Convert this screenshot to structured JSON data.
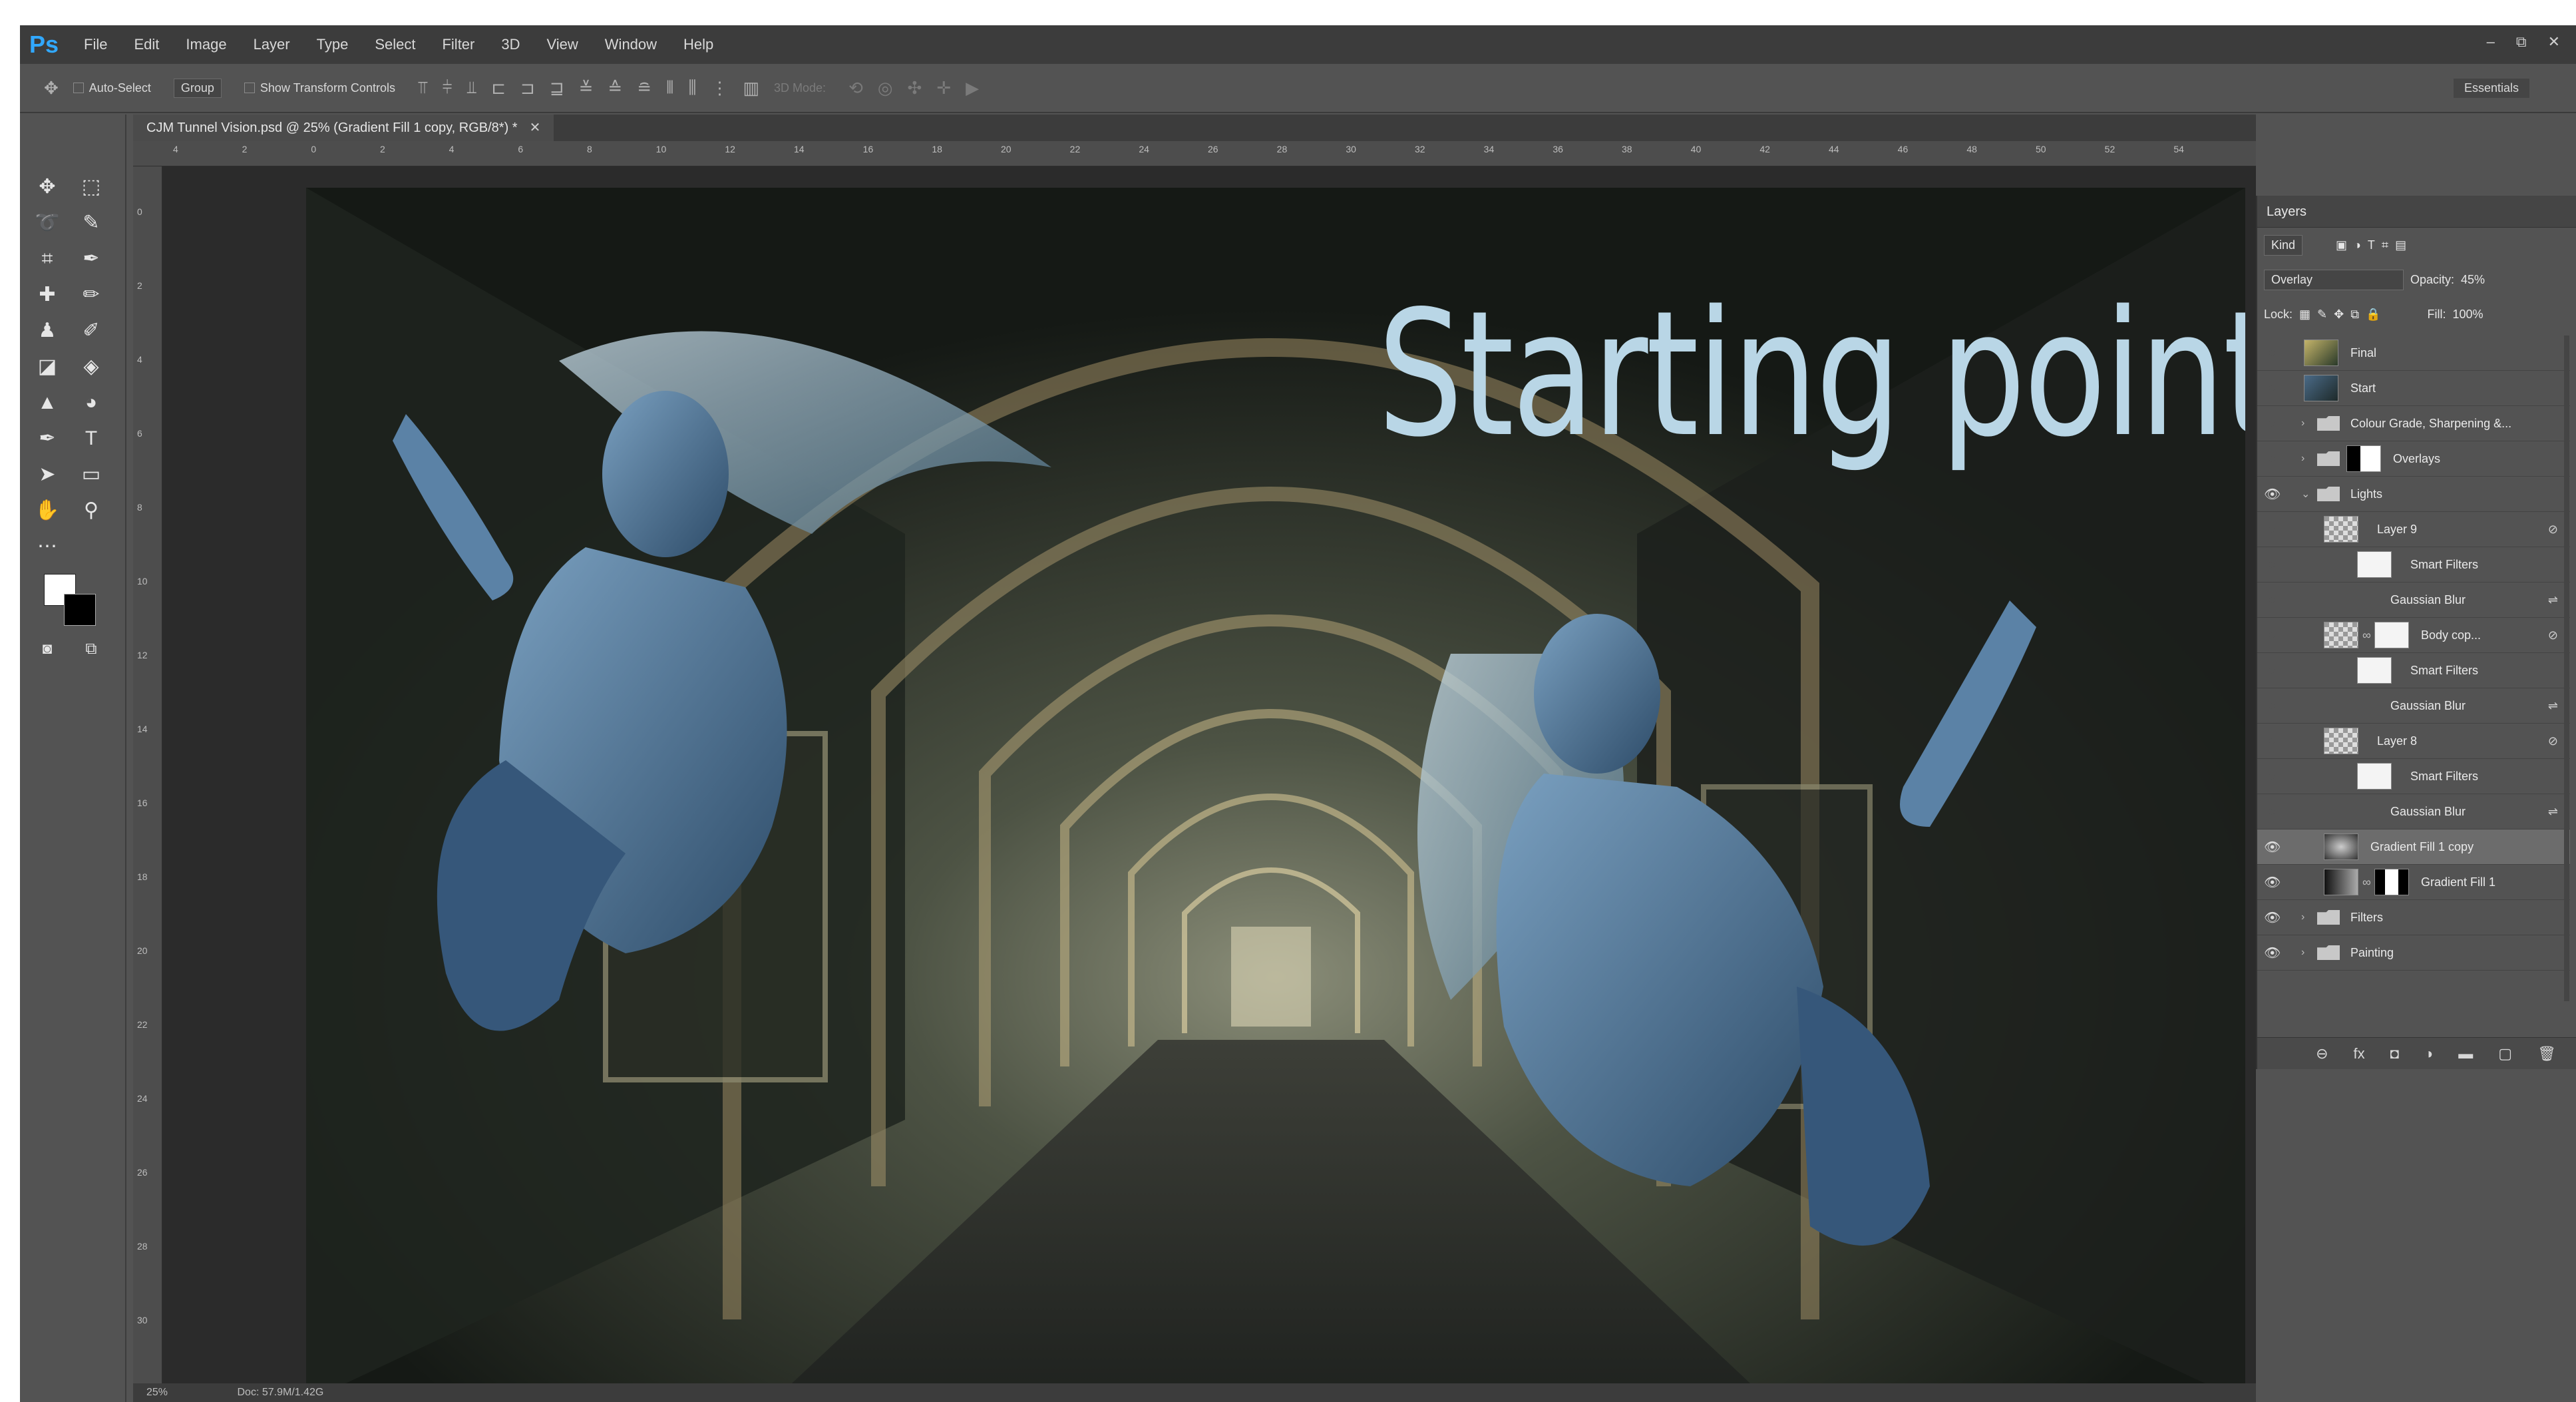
{
  "app": {
    "logo": "Ps"
  },
  "menu": [
    "File",
    "Edit",
    "Image",
    "Layer",
    "Type",
    "Select",
    "Filter",
    "3D",
    "View",
    "Window",
    "Help"
  ],
  "window_controls": {
    "minimize": "–",
    "restore": "⧉",
    "close": "✕"
  },
  "options_bar": {
    "auto_select_label": "Auto-Select",
    "group_value": "Group",
    "show_transform_label": "Show Transform Controls",
    "mode_3d_label": "3D Mode:",
    "workspace": "Essentials"
  },
  "document_tab": {
    "title": "CJM Tunnel Vision.psd @ 25% (Gradient Fill 1 copy, RGB/8*) *",
    "close": "✕"
  },
  "ruler": {
    "top_ticks": [
      "4",
      "2",
      "0",
      "2",
      "4",
      "6",
      "8",
      "10",
      "12",
      "14",
      "16",
      "18",
      "20",
      "22",
      "24",
      "26",
      "28",
      "30",
      "32",
      "34",
      "36",
      "38",
      "40",
      "42",
      "44",
      "46",
      "48",
      "50",
      "52",
      "54"
    ],
    "left_ticks": [
      "0",
      "2",
      "4",
      "6",
      "8",
      "10",
      "12",
      "14",
      "16",
      "18",
      "20",
      "22",
      "24",
      "26",
      "28",
      "30"
    ]
  },
  "canvas": {
    "headline": "Starting point."
  },
  "status_bar": {
    "zoom": "25%",
    "doc": "Doc: 57.9M/1.42G"
  },
  "layers_panel": {
    "tab": "Layers",
    "filter_kind": "Kind",
    "blend_mode": "Overlay",
    "opacity_label": "Opacity:",
    "opacity_value": "45%",
    "lock_label": "Lock:",
    "fill_label": "Fill:",
    "fill_value": "100%",
    "layers": [
      {
        "name": "Final",
        "type": "image",
        "visible": false
      },
      {
        "name": "Start",
        "type": "image",
        "visible": false
      },
      {
        "name": "Colour Grade, Sharpening &...",
        "type": "group",
        "visible": false
      },
      {
        "name": "Overlays",
        "type": "group-mask",
        "visible": false
      },
      {
        "name": "Lights",
        "type": "group-open",
        "visible": true
      },
      {
        "name": "Layer 9",
        "type": "smart",
        "visible": false
      },
      {
        "name": "Smart Filters",
        "type": "filter-mask",
        "visible": false
      },
      {
        "name": "Gaussian Blur",
        "type": "filter",
        "visible": false
      },
      {
        "name": "Body cop...",
        "type": "smart-mask",
        "visible": false
      },
      {
        "name": "Smart Filters",
        "type": "filter-mask",
        "visible": false
      },
      {
        "name": "Gaussian Blur",
        "type": "filter",
        "visible": false
      },
      {
        "name": "Layer 8",
        "type": "smart",
        "visible": false
      },
      {
        "name": "Smart Filters",
        "type": "filter-mask",
        "visible": false
      },
      {
        "name": "Gaussian Blur",
        "type": "filter",
        "visible": false
      },
      {
        "name": "Gradient Fill 1 copy",
        "type": "gradient",
        "visible": true,
        "selected": true
      },
      {
        "name": "Gradient Fill 1",
        "type": "gradient-mask",
        "visible": true
      },
      {
        "name": "Filters",
        "type": "group",
        "visible": true
      },
      {
        "name": "Painting",
        "type": "group",
        "visible": true
      }
    ],
    "bottom_icons": [
      "link-icon",
      "fx-icon",
      "mask-icon",
      "adjustment-icon",
      "folder-icon",
      "new-layer-icon",
      "trash-icon"
    ],
    "bottom_glyphs": [
      "⊖",
      "fx",
      "◘",
      "◑",
      "▬",
      "▢",
      "🗑"
    ]
  },
  "colors": {
    "accent": "#31a8ff",
    "headline": "#b9d6e6"
  }
}
